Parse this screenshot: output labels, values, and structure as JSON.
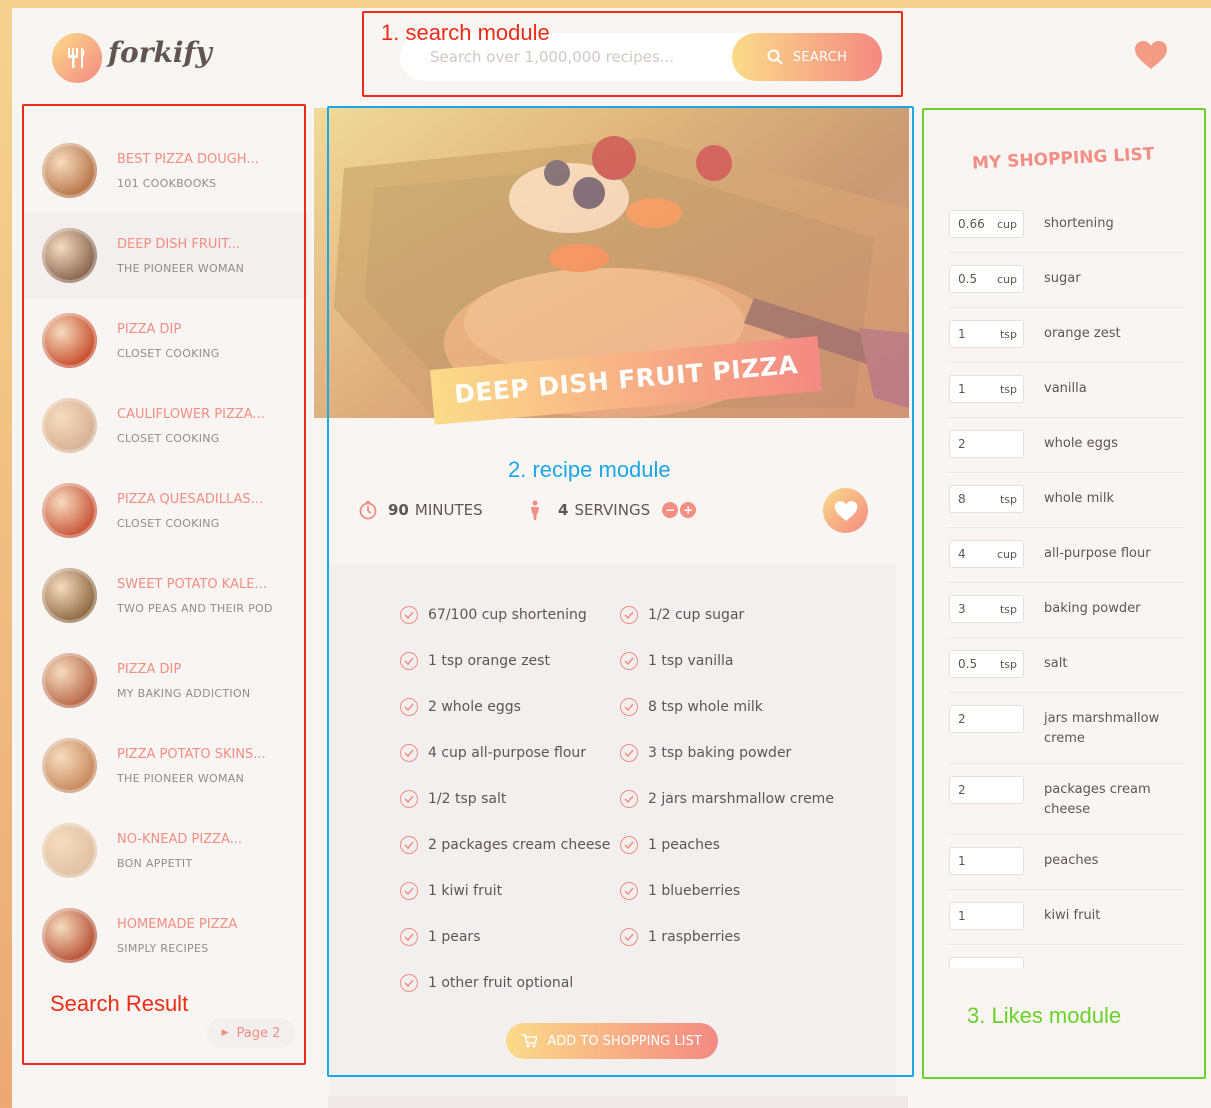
{
  "header": {
    "logo_text": "forkify",
    "search_placeholder": "Search over 1,000,000 recipes...",
    "search_button": "SEARCH"
  },
  "annotations": {
    "search": "1. search module",
    "recipe": "2. recipe module",
    "likes": "3. Likes module",
    "results": "Search Result"
  },
  "results": [
    {
      "title": "BEST PIZZA DOUGH...",
      "publisher": "101 COOKBOOKS",
      "color": "#b8764a",
      "active": false
    },
    {
      "title": "DEEP DISH FRUIT...",
      "publisher": "THE PIONEER WOMAN",
      "color": "#8a6752",
      "active": true
    },
    {
      "title": "PIZZA DIP",
      "publisher": "CLOSET COOKING",
      "color": "#c8502f",
      "active": false
    },
    {
      "title": "CAULIFLOWER PIZZA...",
      "publisher": "CLOSET COOKING",
      "color": "#d7b295",
      "active": false
    },
    {
      "title": "PIZZA QUESADILLAS...",
      "publisher": "CLOSET COOKING",
      "color": "#c9563a",
      "active": false
    },
    {
      "title": "SWEET POTATO KALE...",
      "publisher": "TWO PEAS AND THEIR POD",
      "color": "#8f6a45",
      "active": false
    },
    {
      "title": "PIZZA DIP",
      "publisher": "MY BAKING ADDICTION",
      "color": "#b96a4b",
      "active": false
    },
    {
      "title": "PIZZA POTATO SKINS...",
      "publisher": "THE PIONEER WOMAN",
      "color": "#c98a60",
      "active": false
    },
    {
      "title": "NO-KNEAD PIZZA...",
      "publisher": "BON APPETIT",
      "color": "#e0c2a3",
      "active": false
    },
    {
      "title": "HOMEMADE PIZZA",
      "publisher": "SIMPLY RECIPES",
      "color": "#b8553a",
      "active": false
    }
  ],
  "pagination": {
    "next": "Page 2"
  },
  "recipe": {
    "title": "DEEP DISH FRUIT PIZZA",
    "minutes": "90",
    "minutes_label": "MINUTES",
    "servings": "4",
    "servings_label": "SERVINGS",
    "add_to_list": "ADD TO SHOPPING LIST",
    "ingredients": [
      "67/100 cup shortening",
      "1/2 cup sugar",
      "1 tsp orange zest",
      "1 tsp vanilla",
      "2 whole eggs",
      "8 tsp whole milk",
      "4 cup all-purpose flour",
      "3 tsp baking powder",
      "1/2 tsp salt",
      "2 jars marshmallow creme",
      "2 packages cream cheese",
      "1 peaches",
      "1 kiwi fruit",
      "1 blueberries",
      "1 pears",
      "1 raspberries",
      "1 other fruit optional"
    ]
  },
  "shopping": {
    "title": "MY SHOPPING LIST",
    "items": [
      {
        "count": "0.66",
        "unit": "cup",
        "desc": "shortening"
      },
      {
        "count": "0.5",
        "unit": "cup",
        "desc": "sugar"
      },
      {
        "count": "1",
        "unit": "tsp",
        "desc": "orange zest"
      },
      {
        "count": "1",
        "unit": "tsp",
        "desc": "vanilla"
      },
      {
        "count": "2",
        "unit": "",
        "desc": "whole eggs"
      },
      {
        "count": "8",
        "unit": "tsp",
        "desc": "whole milk"
      },
      {
        "count": "4",
        "unit": "cup",
        "desc": "all-purpose flour"
      },
      {
        "count": "3",
        "unit": "tsp",
        "desc": "baking powder"
      },
      {
        "count": "0.5",
        "unit": "tsp",
        "desc": "salt"
      },
      {
        "count": "2",
        "unit": "",
        "desc": "jars marshmallow creme"
      },
      {
        "count": "2",
        "unit": "",
        "desc": "packages cream cheese"
      },
      {
        "count": "1",
        "unit": "",
        "desc": "peaches"
      },
      {
        "count": "1",
        "unit": "",
        "desc": "kiwi fruit"
      },
      {
        "count": "",
        "unit": "",
        "desc": ""
      }
    ]
  },
  "colors": {
    "accent": "#f38e82",
    "red_annotation": "#ee2b14",
    "blue_annotation": "#1aa7e6",
    "green_annotation": "#6ad12a"
  }
}
